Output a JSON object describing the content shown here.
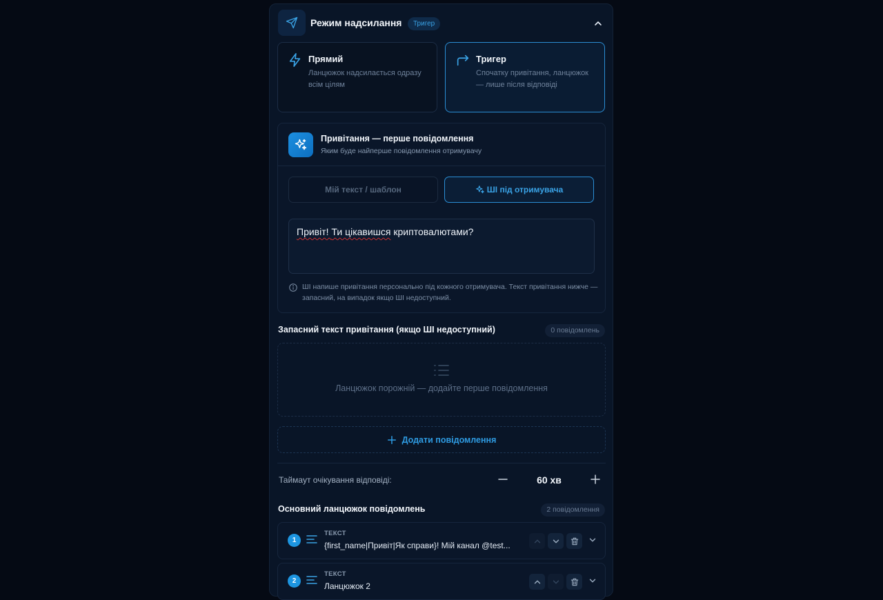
{
  "header": {
    "title": "Режим надсилання",
    "badge": "Тригер",
    "icon": "send-icon"
  },
  "modes": [
    {
      "title": "Прямий",
      "description": "Ланцюжок надсилається одразу всім цілям",
      "icon": "lightning-icon",
      "active": false
    },
    {
      "title": "Тригер",
      "description": "Спочатку привітання, ланцюжок — лише після відповіді",
      "icon": "redirect-arrow-icon",
      "active": true
    }
  ],
  "greeting": {
    "title": "Привітання — перше повідомлення",
    "subtitle": "Яким буде найперше повідомлення отримувачу",
    "tab_custom": "Мій текст / шаблон",
    "tab_ai": "ШІ під отримувача",
    "text_part1": "Привіт! ",
    "text_part2": "Ти цікавишся",
    "text_part3": " криптовалютами?",
    "note": "ШІ напише привітання персонально під кожного отримувача. Текст привітання нижче — запасний, на випадок якщо ШІ недоступний."
  },
  "fallback": {
    "title": "Запасний текст привітання (якщо ШІ недоступний)",
    "count": "0 повідомлень",
    "empty_text": "Ланцюжок порожній — додайте перше повідомлення",
    "add_button": "Додати повідомлення"
  },
  "timeout": {
    "label": "Таймаут очікування відповіді:",
    "value": "60 хв"
  },
  "main_chain": {
    "title": "Основний ланцюжок повідомлень",
    "count": "2 повідомлення",
    "items": [
      {
        "num": "1",
        "type": "ТЕКСТ",
        "value": "{first_name|Привіт|Як справи}! Мій канал @test..."
      },
      {
        "num": "2",
        "type": "ТЕКСТ",
        "value": "Ланцюжок 2"
      }
    ]
  },
  "colors": {
    "accent": "#2b8fd6",
    "background": "#050a14",
    "panel": "#091527"
  }
}
